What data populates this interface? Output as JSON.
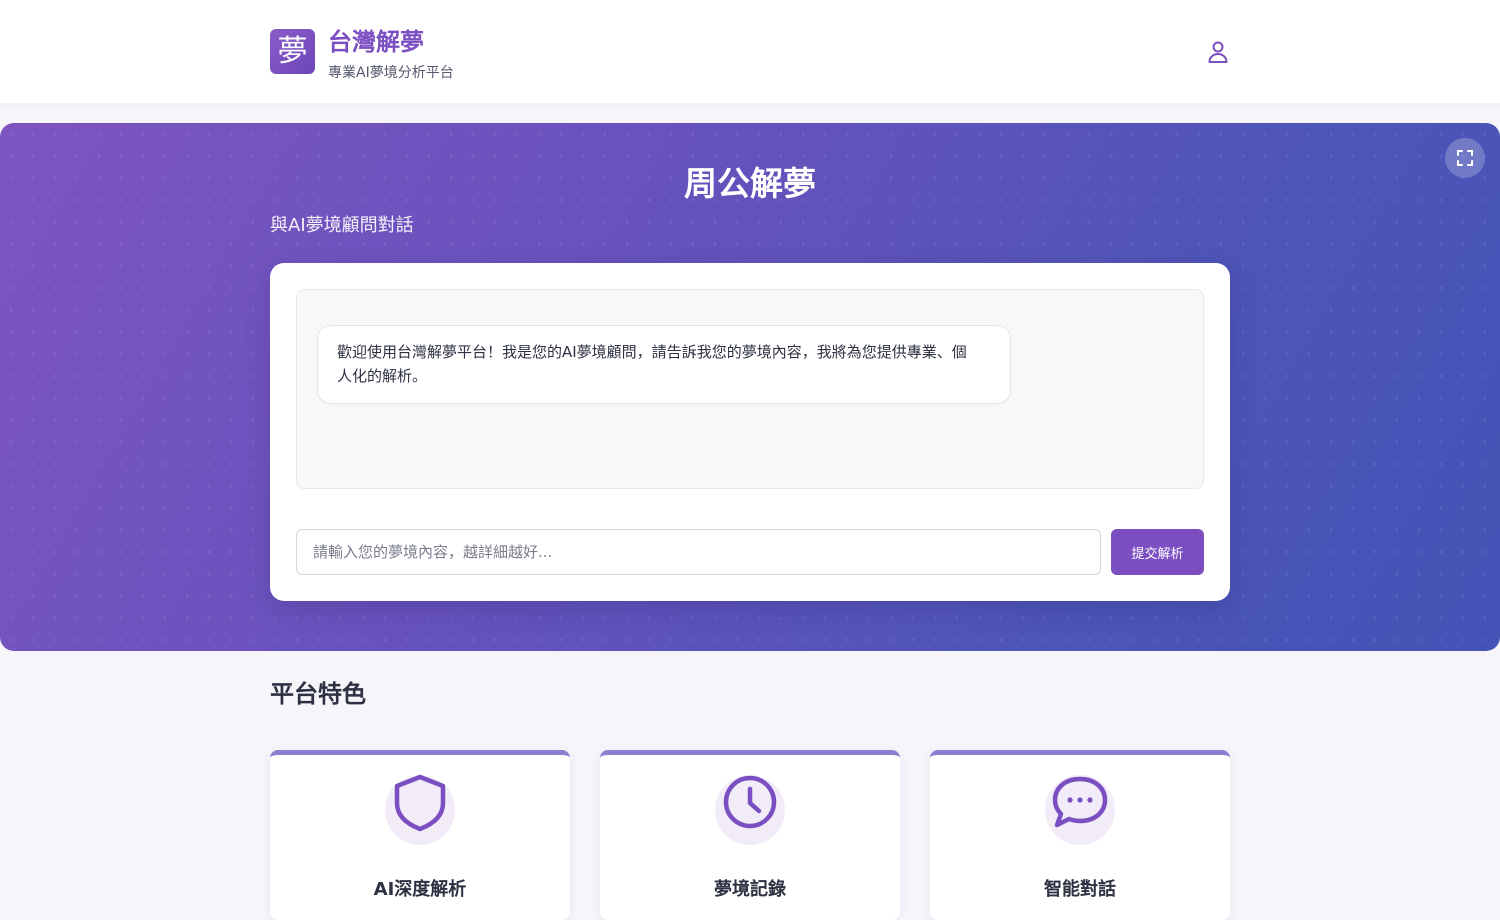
{
  "header": {
    "logo_char": "夢",
    "brand_name": "台灣解夢",
    "tagline": "專業AI夢境分析平台",
    "user_icon": "user-icon"
  },
  "hero": {
    "title": "周公解夢",
    "subtitle": "與AI夢境顧問對話",
    "fullscreen_icon": "fullscreen-icon"
  },
  "chat": {
    "messages": [
      {
        "role": "assistant",
        "text": "歡迎使用台灣解夢平台！我是您的AI夢境顧問，請告訴我您的夢境內容，我將為您提供專業、個人化的解析。"
      }
    ],
    "input": {
      "value": "",
      "placeholder": "請輸入您的夢境內容，越詳細越好..."
    },
    "submit_label": "提交解析"
  },
  "features": {
    "title": "平台特色",
    "items": [
      {
        "icon": "shield-icon",
        "label": "AI深度解析"
      },
      {
        "icon": "clock-icon",
        "label": "夢境記錄"
      },
      {
        "icon": "chat-bubble-icon",
        "label": "智能對話"
      }
    ]
  },
  "colors": {
    "brand": "#7b4fc2",
    "hero_start": "#7d55c0",
    "hero_end": "#4454b6",
    "card_accent": "#8a7fd0",
    "icon_bg": "#f1ecf8"
  }
}
